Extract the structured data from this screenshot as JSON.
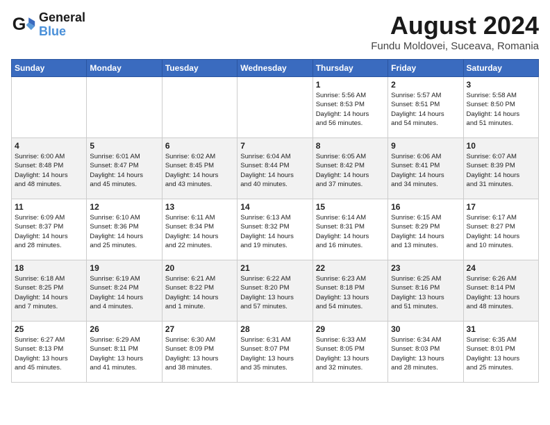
{
  "logo": {
    "line1": "General",
    "line2": "Blue"
  },
  "title": "August 2024",
  "subtitle": "Fundu Moldovei, Suceava, Romania",
  "days_of_week": [
    "Sunday",
    "Monday",
    "Tuesday",
    "Wednesday",
    "Thursday",
    "Friday",
    "Saturday"
  ],
  "weeks": [
    [
      {
        "day": "",
        "info": ""
      },
      {
        "day": "",
        "info": ""
      },
      {
        "day": "",
        "info": ""
      },
      {
        "day": "",
        "info": ""
      },
      {
        "day": "1",
        "info": "Sunrise: 5:56 AM\nSunset: 8:53 PM\nDaylight: 14 hours\nand 56 minutes."
      },
      {
        "day": "2",
        "info": "Sunrise: 5:57 AM\nSunset: 8:51 PM\nDaylight: 14 hours\nand 54 minutes."
      },
      {
        "day": "3",
        "info": "Sunrise: 5:58 AM\nSunset: 8:50 PM\nDaylight: 14 hours\nand 51 minutes."
      }
    ],
    [
      {
        "day": "4",
        "info": "Sunrise: 6:00 AM\nSunset: 8:48 PM\nDaylight: 14 hours\nand 48 minutes."
      },
      {
        "day": "5",
        "info": "Sunrise: 6:01 AM\nSunset: 8:47 PM\nDaylight: 14 hours\nand 45 minutes."
      },
      {
        "day": "6",
        "info": "Sunrise: 6:02 AM\nSunset: 8:45 PM\nDaylight: 14 hours\nand 43 minutes."
      },
      {
        "day": "7",
        "info": "Sunrise: 6:04 AM\nSunset: 8:44 PM\nDaylight: 14 hours\nand 40 minutes."
      },
      {
        "day": "8",
        "info": "Sunrise: 6:05 AM\nSunset: 8:42 PM\nDaylight: 14 hours\nand 37 minutes."
      },
      {
        "day": "9",
        "info": "Sunrise: 6:06 AM\nSunset: 8:41 PM\nDaylight: 14 hours\nand 34 minutes."
      },
      {
        "day": "10",
        "info": "Sunrise: 6:07 AM\nSunset: 8:39 PM\nDaylight: 14 hours\nand 31 minutes."
      }
    ],
    [
      {
        "day": "11",
        "info": "Sunrise: 6:09 AM\nSunset: 8:37 PM\nDaylight: 14 hours\nand 28 minutes."
      },
      {
        "day": "12",
        "info": "Sunrise: 6:10 AM\nSunset: 8:36 PM\nDaylight: 14 hours\nand 25 minutes."
      },
      {
        "day": "13",
        "info": "Sunrise: 6:11 AM\nSunset: 8:34 PM\nDaylight: 14 hours\nand 22 minutes."
      },
      {
        "day": "14",
        "info": "Sunrise: 6:13 AM\nSunset: 8:32 PM\nDaylight: 14 hours\nand 19 minutes."
      },
      {
        "day": "15",
        "info": "Sunrise: 6:14 AM\nSunset: 8:31 PM\nDaylight: 14 hours\nand 16 minutes."
      },
      {
        "day": "16",
        "info": "Sunrise: 6:15 AM\nSunset: 8:29 PM\nDaylight: 14 hours\nand 13 minutes."
      },
      {
        "day": "17",
        "info": "Sunrise: 6:17 AM\nSunset: 8:27 PM\nDaylight: 14 hours\nand 10 minutes."
      }
    ],
    [
      {
        "day": "18",
        "info": "Sunrise: 6:18 AM\nSunset: 8:25 PM\nDaylight: 14 hours\nand 7 minutes."
      },
      {
        "day": "19",
        "info": "Sunrise: 6:19 AM\nSunset: 8:24 PM\nDaylight: 14 hours\nand 4 minutes."
      },
      {
        "day": "20",
        "info": "Sunrise: 6:21 AM\nSunset: 8:22 PM\nDaylight: 14 hours\nand 1 minute."
      },
      {
        "day": "21",
        "info": "Sunrise: 6:22 AM\nSunset: 8:20 PM\nDaylight: 13 hours\nand 57 minutes."
      },
      {
        "day": "22",
        "info": "Sunrise: 6:23 AM\nSunset: 8:18 PM\nDaylight: 13 hours\nand 54 minutes."
      },
      {
        "day": "23",
        "info": "Sunrise: 6:25 AM\nSunset: 8:16 PM\nDaylight: 13 hours\nand 51 minutes."
      },
      {
        "day": "24",
        "info": "Sunrise: 6:26 AM\nSunset: 8:14 PM\nDaylight: 13 hours\nand 48 minutes."
      }
    ],
    [
      {
        "day": "25",
        "info": "Sunrise: 6:27 AM\nSunset: 8:13 PM\nDaylight: 13 hours\nand 45 minutes."
      },
      {
        "day": "26",
        "info": "Sunrise: 6:29 AM\nSunset: 8:11 PM\nDaylight: 13 hours\nand 41 minutes."
      },
      {
        "day": "27",
        "info": "Sunrise: 6:30 AM\nSunset: 8:09 PM\nDaylight: 13 hours\nand 38 minutes."
      },
      {
        "day": "28",
        "info": "Sunrise: 6:31 AM\nSunset: 8:07 PM\nDaylight: 13 hours\nand 35 minutes."
      },
      {
        "day": "29",
        "info": "Sunrise: 6:33 AM\nSunset: 8:05 PM\nDaylight: 13 hours\nand 32 minutes."
      },
      {
        "day": "30",
        "info": "Sunrise: 6:34 AM\nSunset: 8:03 PM\nDaylight: 13 hours\nand 28 minutes."
      },
      {
        "day": "31",
        "info": "Sunrise: 6:35 AM\nSunset: 8:01 PM\nDaylight: 13 hours\nand 25 minutes."
      }
    ]
  ]
}
